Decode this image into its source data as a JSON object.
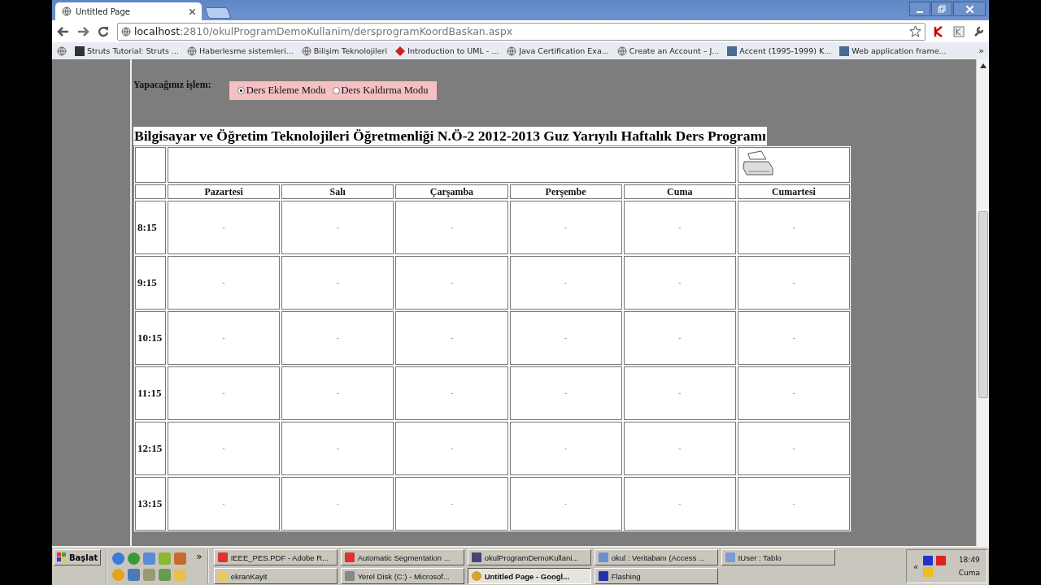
{
  "browser": {
    "tabs": [
      {
        "title": "Untitled Page",
        "selected": true
      }
    ],
    "address": {
      "host": "localhost",
      "rest": ":2810/okulProgramDemoKullanim/dersprogramKoordBaskan.aspx"
    },
    "bookmarks": [
      {
        "label": "Struts Tutorial: Struts ..."
      },
      {
        "label": "Haberlesme sistemleri..."
      },
      {
        "label": "Bilişim Teknolojileri"
      },
      {
        "label": "Introduction to UML - ..."
      },
      {
        "label": "Java Certification Exa..."
      },
      {
        "label": "Create an Account – J..."
      },
      {
        "label": "Accent (1995-1999) K..."
      },
      {
        "label": "Web application frame..."
      }
    ],
    "more": "»"
  },
  "page": {
    "mode_label": "Yapacağınız işlem:",
    "modes": [
      {
        "label": "Ders Ekleme Modu",
        "selected": true
      },
      {
        "label": "Ders Kaldırma Modu",
        "selected": false
      }
    ],
    "title": "Bilgisayar ve Öğretim Teknolojileri Öğretmenliği N.Ö-2 2012-2013 Guz Yarıyılı Haftalık Ders Programı",
    "days": [
      "Pazartesi",
      "Salı",
      "Çarşamba",
      "Perşembe",
      "Cuma",
      "Cumartesi"
    ],
    "rows": [
      {
        "time": "8:15",
        "cells": [
          "-",
          "-",
          "-",
          "-",
          "-",
          "-"
        ]
      },
      {
        "time": "9:15",
        "cells": [
          "-",
          "-",
          "-",
          "-",
          "-",
          "-"
        ]
      },
      {
        "time": "10:15",
        "cells": [
          "-",
          "-",
          "-",
          "-",
          "-",
          "-"
        ]
      },
      {
        "time": "11:15",
        "cells": [
          "-",
          "-",
          "-",
          "-",
          "-",
          "-"
        ]
      },
      {
        "time": "12:15",
        "cells": [
          "-",
          "-",
          "-",
          "-",
          "-",
          "-"
        ]
      },
      {
        "time": "13:15",
        "cells": [
          "-",
          "-",
          "-",
          "-",
          "-",
          "-"
        ]
      }
    ]
  },
  "taskbar": {
    "start": "Başlat",
    "more": "»",
    "tasks": [
      {
        "label": "IEEE_PES.PDF - Adobe R...",
        "selected": false
      },
      {
        "label": "Automatic Segmentation ...",
        "selected": false
      },
      {
        "label": "okulProgramDemoKullani...",
        "selected": false
      },
      {
        "label": "okul : Veritabanı (Access ...",
        "selected": false
      },
      {
        "label": "tUser : Tablo",
        "selected": false
      },
      {
        "label": "ekranKayit",
        "selected": false
      },
      {
        "label": "Yerel Disk (C:) - Microsof...",
        "selected": false
      },
      {
        "label": "Untitled Page - Googl...",
        "selected": true
      },
      {
        "label": "Flashing",
        "selected": false
      }
    ],
    "tray": {
      "expand": "«",
      "time": "18:49",
      "day": "Cuma"
    }
  }
}
